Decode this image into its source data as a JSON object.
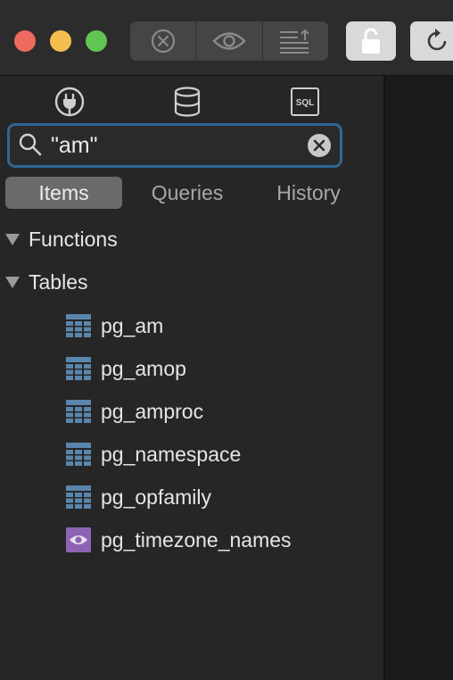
{
  "search": {
    "value": "\"am\""
  },
  "tabs": [
    {
      "label": "Items",
      "active": true
    },
    {
      "label": "Queries",
      "active": false
    },
    {
      "label": "History",
      "active": false
    }
  ],
  "toolbar": {
    "icons": [
      "cancel-icon",
      "preview-icon",
      "export-icon",
      "lock-icon",
      "reload-icon"
    ]
  },
  "source_bar": {
    "icons": [
      "plug-icon",
      "database-icon",
      "sql-icon"
    ],
    "sql_label": "SQL"
  },
  "groups": [
    {
      "label": "Functions"
    },
    {
      "label": "Tables"
    }
  ],
  "items": [
    {
      "label": "pg_am",
      "icon": "table-icon"
    },
    {
      "label": "pg_amop",
      "icon": "table-icon"
    },
    {
      "label": "pg_amproc",
      "icon": "table-icon"
    },
    {
      "label": "pg_namespace",
      "icon": "table-icon"
    },
    {
      "label": "pg_opfamily",
      "icon": "table-icon"
    },
    {
      "label": "pg_timezone_names",
      "icon": "view-icon"
    }
  ],
  "colors": {
    "accent": "#2f6794",
    "table_icon": "#5a86ad",
    "view_icon": "#8e63b5",
    "close": "#ed6a5e",
    "minimize": "#f4bf4f",
    "zoom": "#61c554"
  }
}
